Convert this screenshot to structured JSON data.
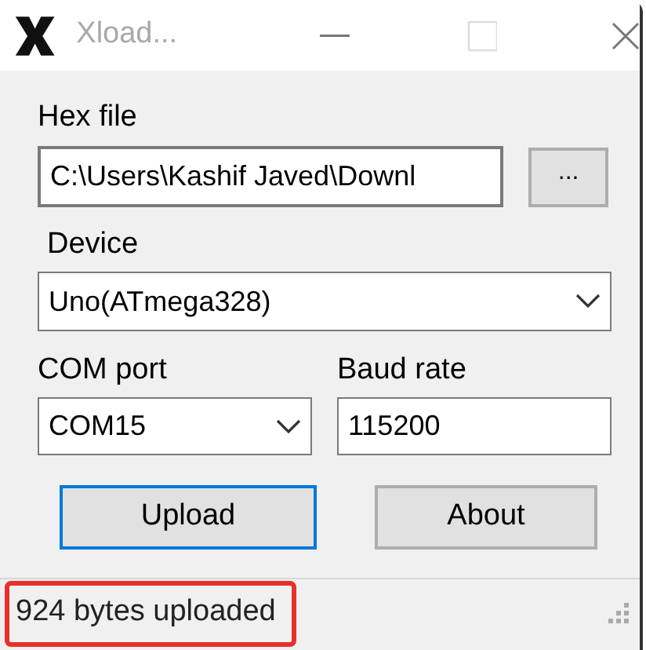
{
  "window": {
    "title": "Xload..."
  },
  "hex_file": {
    "label": "Hex file",
    "value": "C:\\Users\\Kashif Javed\\Downl",
    "browse_button": "..."
  },
  "device": {
    "label": "Device",
    "value": "Uno(ATmega328)"
  },
  "com_port": {
    "label": "COM port",
    "value": "COM15"
  },
  "baud_rate": {
    "label": "Baud rate",
    "value": "115200"
  },
  "buttons": [
    {
      "label": "Upload",
      "focused": true
    },
    {
      "label": "About",
      "focused": false
    }
  ],
  "status_bar": {
    "text": "924 bytes uploaded",
    "highlighted": true
  }
}
